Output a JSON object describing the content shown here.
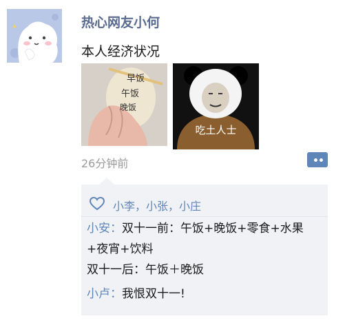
{
  "post": {
    "author": "热心网友小何",
    "text": "本人经济状况",
    "timestamp": "26分钟前",
    "images": [
      {
        "handwritten_lines": [
          "早饭",
          "午饭",
          "晚饭"
        ]
      },
      {
        "caption": "吃土人士"
      }
    ]
  },
  "likes": {
    "names": "小李，小张，小庄"
  },
  "comments": [
    {
      "author": "小安",
      "separator": "：",
      "text": "双十一前：午饭+晚饭+零食+水果+夜宵+饮料"
    },
    {
      "author": "",
      "separator": "",
      "text": "双十一后：午饭＋晚饭"
    },
    {
      "author": "小卢",
      "separator": "：",
      "text": "我恨双十一!"
    }
  ],
  "colors": {
    "link_blue": "#5f86b8",
    "author_name": "#5a6b8f",
    "timestamp_gray": "#9a9a9a",
    "interaction_bg": "#f1f2f6",
    "avatar_bg": "#b9c8e6"
  },
  "icons": {
    "more": "more-options-icon",
    "like": "heart-icon"
  }
}
